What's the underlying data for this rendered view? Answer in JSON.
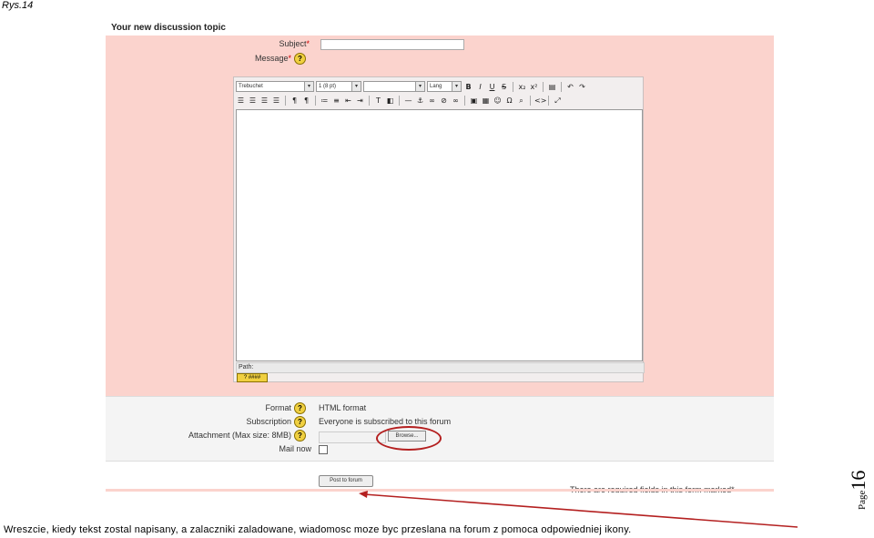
{
  "figure_label": "Rys.14",
  "form": {
    "title": "Your new discussion topic",
    "subject_label": "Subject",
    "message_label": "Message",
    "required_mark": "*",
    "help_icon": "question-mark-icon",
    "editor": {
      "font_select": "Trebuchet",
      "size_select": "1 (8 pt)",
      "lang_select": "Lang",
      "path_label": "Path:",
      "help_badge": "? ####"
    },
    "format_label": "Format",
    "format_value": "HTML format",
    "subscription_label": "Subscription",
    "subscription_value": "Everyone is subscribed to this forum",
    "attachment_label": "Attachment (Max size: 8MB)",
    "browse_label": "Browse...",
    "mail_now_label": "Mail now",
    "post_button": "Post to forum",
    "required_note": "There are required fields in this form marked*"
  },
  "caption": "Wreszcie, kiedy tekst zostal napisany, a zalaczniki zaladowane, wiadomosc moze byc przeslana na forum z pomoca odpowiedniej ikony.",
  "page": {
    "word": "Page",
    "number": "16"
  },
  "colors": {
    "form_background": "#fbd3cd",
    "annotation": "#b42020"
  }
}
